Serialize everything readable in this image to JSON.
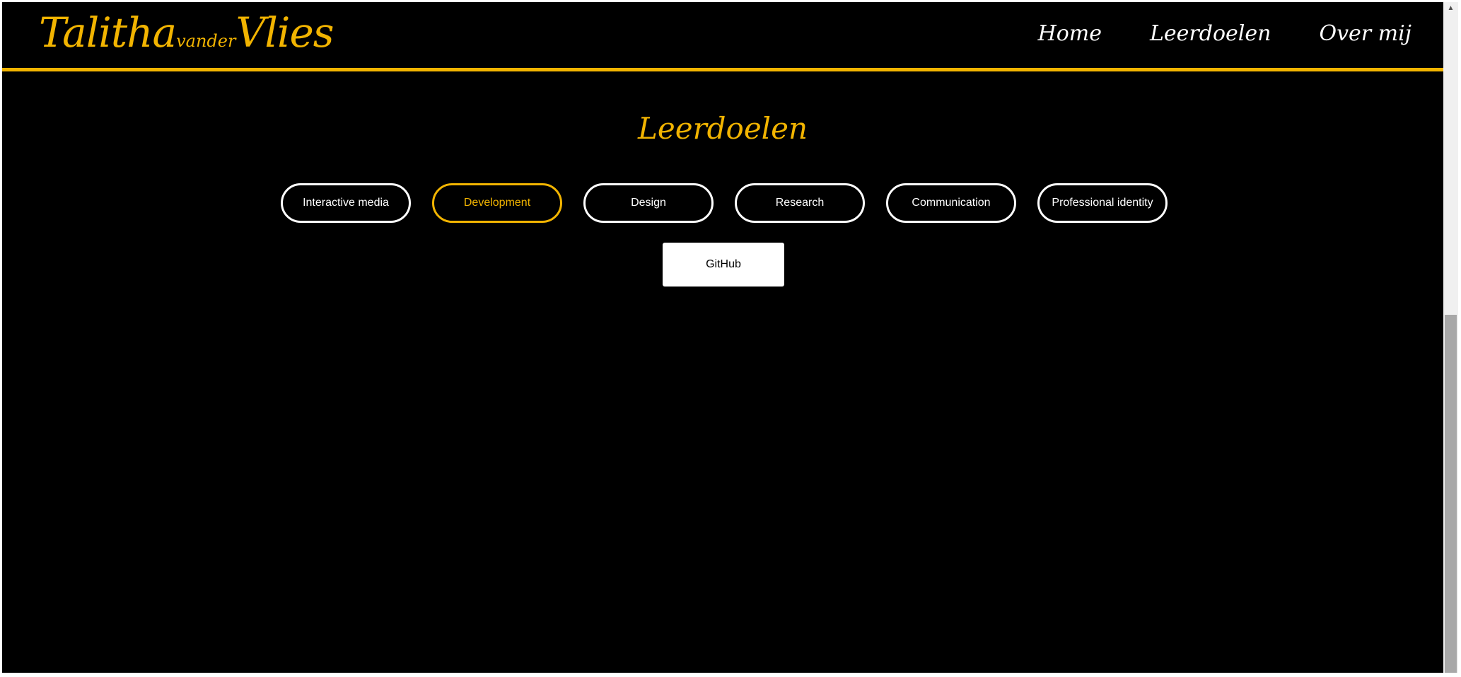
{
  "header": {
    "logo": {
      "first": "Talitha",
      "middle": "vander",
      "last": "Vlies"
    },
    "nav": [
      {
        "label": "Home"
      },
      {
        "label": "Leerdoelen"
      },
      {
        "label": "Over mij"
      }
    ]
  },
  "main": {
    "title": "Leerdoelen",
    "tabs": [
      {
        "label": "Interactive media",
        "active": false
      },
      {
        "label": "Development",
        "active": true
      },
      {
        "label": "Design",
        "active": false
      },
      {
        "label": "Research",
        "active": false
      },
      {
        "label": "Communication",
        "active": false
      },
      {
        "label": "Professional identity",
        "active": false
      }
    ],
    "github_label": "GitHub"
  },
  "scrollbar": {
    "up_icon": "arrow-up-icon"
  },
  "colors": {
    "background": "#000000",
    "accent": "#f2b400",
    "text": "#ffffff"
  }
}
